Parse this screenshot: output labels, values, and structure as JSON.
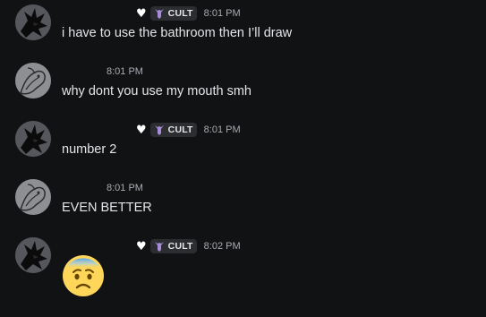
{
  "messages": [
    {
      "author_kind": "crow",
      "heart": "♥",
      "tag": "CULT",
      "time": "8:01 PM",
      "text": "i have to use the bathroom then I’ll draw"
    },
    {
      "author_kind": "sketch",
      "time": "8:01 PM",
      "text": "why dont you use my mouth smh"
    },
    {
      "author_kind": "crow",
      "heart": "♥",
      "tag": "CULT",
      "time": "8:01 PM",
      "text": "number 2"
    },
    {
      "author_kind": "sketch",
      "time": "8:01 PM",
      "text": "EVEN BETTER"
    },
    {
      "author_kind": "crow",
      "heart": "♥",
      "tag": "CULT",
      "time": "8:02 PM",
      "emoji": "anxious-face-emoji"
    }
  ],
  "colors": {
    "background": "#111214",
    "tag_background": "#2b2d31",
    "tag_icon": "#a78bdb",
    "timestamp": "#a9abb1",
    "message_text": "#e3e5e8"
  }
}
